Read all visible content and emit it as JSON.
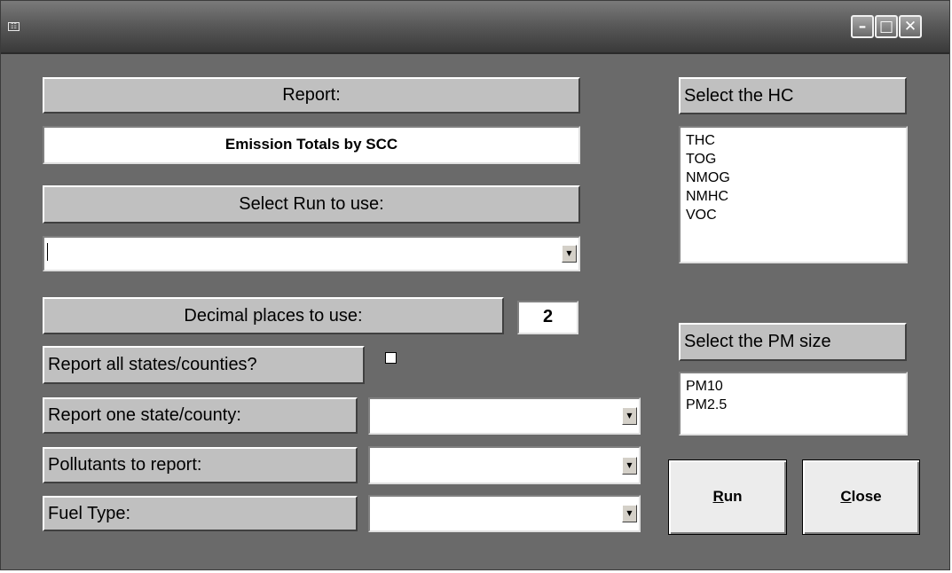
{
  "window": {
    "icon": "system-menu-icon",
    "buttons": {
      "minimize": "–",
      "maximize": "□",
      "close": "✕"
    }
  },
  "report": {
    "label": "Report:",
    "value": "Emission Totals by SCC"
  },
  "run": {
    "label": "Select Run to use:",
    "value": ""
  },
  "decimal": {
    "label": "Decimal places to use:",
    "value": "2"
  },
  "all_states": {
    "label": "Report all states/counties?",
    "checked": false
  },
  "one_state": {
    "label": "Report one state/county:",
    "value": ""
  },
  "pollutants": {
    "label": "Pollutants to report:",
    "value": ""
  },
  "fuel": {
    "label": "Fuel Type:",
    "value": ""
  },
  "hc": {
    "label": "Select the HC",
    "items": [
      "THC",
      "TOG",
      "NMOG",
      "NMHC",
      "VOC"
    ]
  },
  "pm": {
    "label": "Select the PM size",
    "items": [
      "PM10",
      "PM2.5"
    ]
  },
  "buttons": {
    "run": {
      "accel": "R",
      "rest": "un"
    },
    "close": {
      "accel": "C",
      "rest": "lose"
    }
  },
  "colors": {
    "form_background": "#6a6a6a",
    "label_background": "#c0c0c0",
    "field_background": "#ffffff"
  }
}
